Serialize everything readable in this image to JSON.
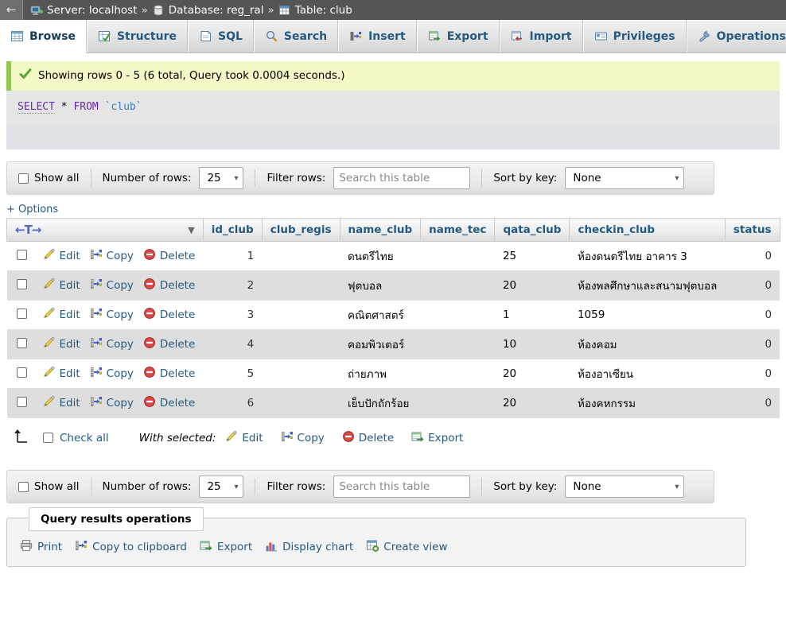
{
  "topbar": {
    "back_label": "←",
    "breadcrumb": [
      {
        "icon": "server-icon",
        "label": "Server: localhost"
      },
      {
        "icon": "database-icon",
        "label": "Database: reg_ral"
      },
      {
        "icon": "table-icon",
        "label": "Table: club"
      }
    ],
    "separator": "»"
  },
  "tabs": [
    {
      "label": "Browse",
      "icon": "browse-icon",
      "active": true
    },
    {
      "label": "Structure",
      "icon": "structure-icon",
      "active": false
    },
    {
      "label": "SQL",
      "icon": "sql-icon",
      "active": false
    },
    {
      "label": "Search",
      "icon": "search-icon",
      "active": false
    },
    {
      "label": "Insert",
      "icon": "insert-icon",
      "active": false
    },
    {
      "label": "Export",
      "icon": "export-icon",
      "active": false
    },
    {
      "label": "Import",
      "icon": "import-icon",
      "active": false
    },
    {
      "label": "Privileges",
      "icon": "privileges-icon",
      "active": false
    },
    {
      "label": "Operations",
      "icon": "operations-icon",
      "active": false
    },
    {
      "label": "",
      "icon": "tracking-icon",
      "active": false
    }
  ],
  "status": {
    "icon": "success-check-icon",
    "message": "Showing rows 0 - 5 (6 total, Query took 0.0004 seconds.)"
  },
  "sql": {
    "keyword1": "SELECT",
    "star": "*",
    "keyword2": "FROM",
    "identifier": "`club`"
  },
  "filter_bar": {
    "show_all_label": "Show all",
    "number_of_rows_label": "Number of rows:",
    "number_of_rows_value": "25",
    "filter_rows_label": "Filter rows:",
    "filter_rows_placeholder": "Search this table",
    "sort_by_key_label": "Sort by key:",
    "sort_by_key_value": "None"
  },
  "options_link": "+ Options",
  "table": {
    "sort_header_symbol": "←T→",
    "columns": [
      "id_club",
      "club_regis",
      "name_club",
      "name_tec",
      "qata_club",
      "checkin_club",
      "status"
    ],
    "row_actions": [
      {
        "label": "Edit",
        "icon": "edit-pencil-icon"
      },
      {
        "label": "Copy",
        "icon": "copy-icon"
      },
      {
        "label": "Delete",
        "icon": "delete-icon"
      }
    ],
    "rows": [
      {
        "id_club": "1",
        "club_regis": "",
        "name_club": "ดนตรีไทย",
        "name_tec": "",
        "qata_club": "25",
        "checkin_club": "ห้องดนตรีไทย อาคาร 3",
        "status": "0"
      },
      {
        "id_club": "2",
        "club_regis": "",
        "name_club": "ฟุตบอล",
        "name_tec": "",
        "qata_club": "20",
        "checkin_club": "ห้องพลศึกษาและสนามฟุตบอล",
        "status": "0"
      },
      {
        "id_club": "3",
        "club_regis": "",
        "name_club": "คณิตศาสตร์",
        "name_tec": "",
        "qata_club": "1",
        "checkin_club": "1059",
        "status": "0"
      },
      {
        "id_club": "4",
        "club_regis": "",
        "name_club": "คอมพิวเตอร์",
        "name_tec": "",
        "qata_club": "10",
        "checkin_club": "ห้องคอม",
        "status": "0"
      },
      {
        "id_club": "5",
        "club_regis": "",
        "name_club": "ถ่ายภาพ",
        "name_tec": "",
        "qata_club": "20",
        "checkin_club": "ห้องอาเซียน",
        "status": "0"
      },
      {
        "id_club": "6",
        "club_regis": "",
        "name_club": "เย็บปักถักร้อย",
        "name_tec": "",
        "qata_club": "20",
        "checkin_club": "ห้องคหกรรม",
        "status": "0"
      }
    ]
  },
  "with_selected": {
    "check_all_label": "Check all",
    "label": "With selected:",
    "actions": [
      {
        "label": "Edit",
        "icon": "edit-pencil-icon"
      },
      {
        "label": "Copy",
        "icon": "copy-icon"
      },
      {
        "label": "Delete",
        "icon": "delete-icon"
      },
      {
        "label": "Export",
        "icon": "export-icon"
      }
    ]
  },
  "query_operations": {
    "legend": "Query results operations",
    "items": [
      {
        "label": "Print",
        "icon": "printer-icon"
      },
      {
        "label": "Copy to clipboard",
        "icon": "copy-icon"
      },
      {
        "label": "Export",
        "icon": "export-icon"
      },
      {
        "label": "Display chart",
        "icon": "chart-icon"
      },
      {
        "label": "Create view",
        "icon": "create-view-icon"
      }
    ]
  },
  "colors": {
    "topbar_bg": "#555555",
    "tab_text": "#235a81",
    "success_bg": "#f3f8c6",
    "success_border": "#8fca55",
    "sql_bg": "#e5e5e5",
    "row_even_bg": "#dedede",
    "link": "#235a81"
  }
}
